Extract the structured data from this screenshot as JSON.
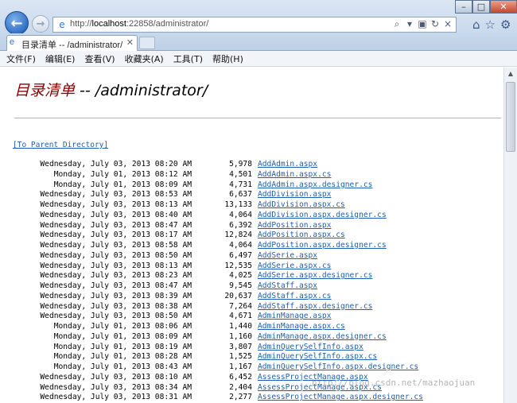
{
  "browser": {
    "url_host": "localhost",
    "url_rest": ":22858/administrator/",
    "url_scheme": "http://",
    "tab_title": "目录清单 -- /administrator/",
    "tab_close": "✕",
    "back_glyph": "←",
    "forward_glyph": "→",
    "minimize_glyph": "–",
    "maximize_glyph": "□",
    "close_glyph": "✕"
  },
  "menu": [
    "文件(F)",
    "编辑(E)",
    "查看(V)",
    "收藏夹(A)",
    "工具(T)",
    "帮助(H)"
  ],
  "page": {
    "heading_prefix": "目录清单",
    "heading_path": " -- /administrator/",
    "parent_link": "[To Parent Directory]"
  },
  "files": [
    {
      "date": "Wednesday, July 03, 2013 08:20 AM",
      "size": "5,978",
      "name": "AddAdmin.aspx"
    },
    {
      "date": "Monday, July 01, 2013 08:12 AM",
      "size": "4,501",
      "name": "AddAdmin.aspx.cs"
    },
    {
      "date": "Monday, July 01, 2013 08:09 AM",
      "size": "4,731",
      "name": "AddAdmin.aspx.designer.cs"
    },
    {
      "date": "Wednesday, July 03, 2013 08:53 AM",
      "size": "6,637",
      "name": "AddDivision.aspx"
    },
    {
      "date": "Wednesday, July 03, 2013 08:13 AM",
      "size": "13,133",
      "name": "AddDivision.aspx.cs"
    },
    {
      "date": "Wednesday, July 03, 2013 08:40 AM",
      "size": "4,064",
      "name": "AddDivision.aspx.designer.cs"
    },
    {
      "date": "Wednesday, July 03, 2013 08:47 AM",
      "size": "6,392",
      "name": "AddPosition.aspx"
    },
    {
      "date": "Wednesday, July 03, 2013 08:17 AM",
      "size": "12,824",
      "name": "AddPosition.aspx.cs"
    },
    {
      "date": "Wednesday, July 03, 2013 08:58 AM",
      "size": "4,064",
      "name": "AddPosition.aspx.designer.cs"
    },
    {
      "date": "Wednesday, July 03, 2013 08:50 AM",
      "size": "6,497",
      "name": "AddSerie.aspx"
    },
    {
      "date": "Wednesday, July 03, 2013 08:13 AM",
      "size": "12,535",
      "name": "AddSerie.aspx.cs"
    },
    {
      "date": "Wednesday, July 03, 2013 08:23 AM",
      "size": "4,025",
      "name": "AddSerie.aspx.designer.cs"
    },
    {
      "date": "Wednesday, July 03, 2013 08:47 AM",
      "size": "9,545",
      "name": "AddStaff.aspx"
    },
    {
      "date": "Wednesday, July 03, 2013 08:39 AM",
      "size": "20,637",
      "name": "AddStaff.aspx.cs"
    },
    {
      "date": "Wednesday, July 03, 2013 08:38 AM",
      "size": "7,264",
      "name": "AddStaff.aspx.designer.cs"
    },
    {
      "date": "Wednesday, July 03, 2013 08:50 AM",
      "size": "4,671",
      "name": "AdminManage.aspx"
    },
    {
      "date": "Monday, July 01, 2013 08:06 AM",
      "size": "1,440",
      "name": "AdminManage.aspx.cs"
    },
    {
      "date": "Monday, July 01, 2013 08:09 AM",
      "size": "1,160",
      "name": "AdminManage.aspx.designer.cs"
    },
    {
      "date": "Monday, July 01, 2013 08:19 AM",
      "size": "3,807",
      "name": "AdminQuerySelfInfo.aspx"
    },
    {
      "date": "Monday, July 01, 2013 08:28 AM",
      "size": "1,525",
      "name": "AdminQuerySelfInfo.aspx.cs"
    },
    {
      "date": "Monday, July 01, 2013 08:43 AM",
      "size": "1,167",
      "name": "AdminQuerySelfInfo.aspx.designer.cs"
    },
    {
      "date": "Wednesday, July 03, 2013 08:10 AM",
      "size": "6,452",
      "name": "AssessProjectManage.aspx"
    },
    {
      "date": "Wednesday, July 03, 2013 08:34 AM",
      "size": "2,404",
      "name": "AssessProjectManage.aspx.cs"
    },
    {
      "date": "Wednesday, July 03, 2013 08:31 AM",
      "size": "2,277",
      "name": "AssessProjectManage.aspx.designer.cs"
    }
  ],
  "watermark": "http://blog.csdn.net/mazhaojuan"
}
